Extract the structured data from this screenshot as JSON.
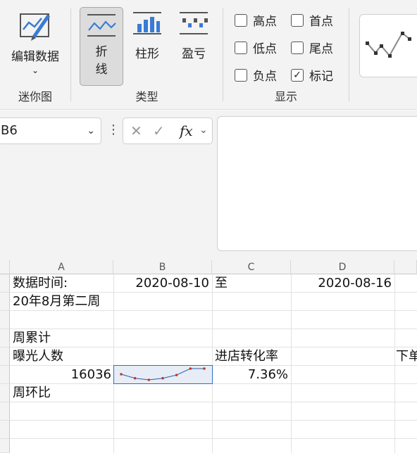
{
  "ribbon": {
    "edit_data": {
      "label": "编辑数据",
      "icon": "edit-data-icon"
    },
    "groups": {
      "sparkline": "迷你图",
      "type": "类型",
      "show": "显示"
    },
    "type_buttons": [
      {
        "label_line1": "折",
        "label_line2": "线",
        "icon": "line-sparkline-icon",
        "active": true
      },
      {
        "label": "柱形",
        "icon": "column-sparkline-icon",
        "active": false
      },
      {
        "label": "盈亏",
        "icon": "win-loss-sparkline-icon",
        "active": false
      }
    ],
    "show_options": [
      {
        "label": "高点",
        "checked": false
      },
      {
        "label": "首点",
        "checked": false
      },
      {
        "label": "低点",
        "checked": false
      },
      {
        "label": "尾点",
        "checked": false
      },
      {
        "label": "负点",
        "checked": false
      },
      {
        "label": "标记",
        "checked": true
      }
    ]
  },
  "formula_bar": {
    "name_box": "B6",
    "formula": ""
  },
  "sheet": {
    "columns": [
      "A",
      "B",
      "C",
      "D"
    ],
    "cells": {
      "A1": "数据时间:",
      "B1": "2020-08-10",
      "C1": "至",
      "D1": "2020-08-16",
      "A2": "20年8月第二周",
      "A4": "周累计",
      "A5": "曝光人数",
      "C5": "进店转化率",
      "E5": "下单",
      "A6": "16036",
      "C6": "7.36%",
      "A7": "周环比"
    },
    "sparkline": {
      "values": [
        8,
        3,
        1,
        3,
        7,
        15,
        15
      ]
    }
  },
  "colors": {
    "accent": "#2f6fc9",
    "sparkline": "#c0392b",
    "sparkline_line": "#2e5cab"
  }
}
